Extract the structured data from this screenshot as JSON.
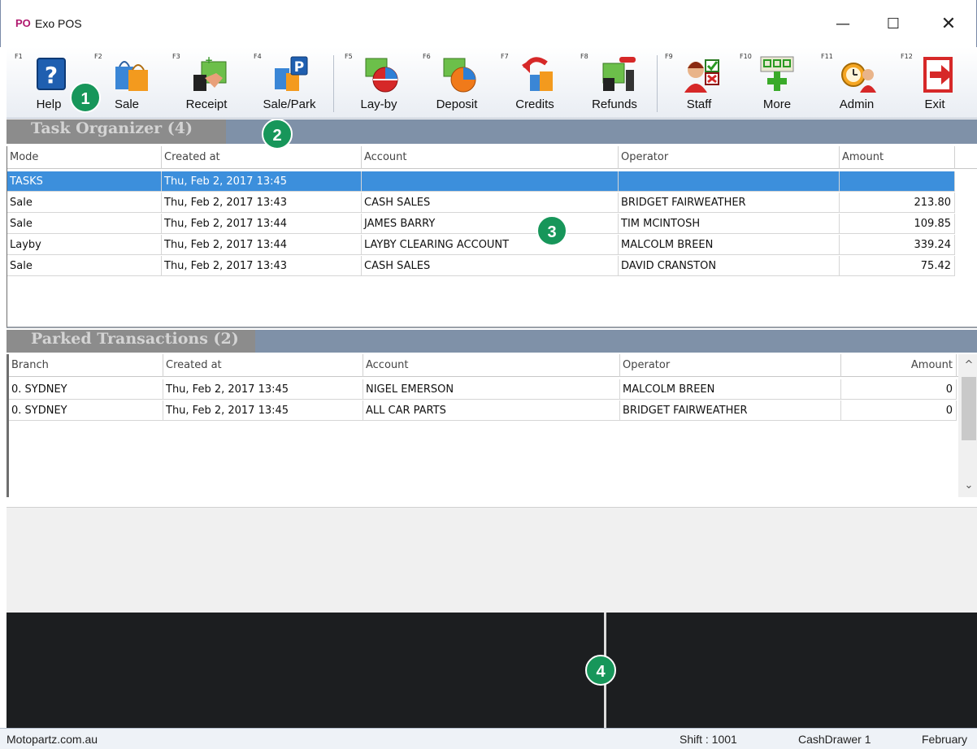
{
  "window": {
    "logo": "PO",
    "title": "Exo POS",
    "minimize": "—",
    "maximize": "☐",
    "close": "✕"
  },
  "toolbar": [
    {
      "key": "F1",
      "label": "Help",
      "icon": "help-icon"
    },
    {
      "key": "F2",
      "label": "Sale",
      "icon": "shopping-bags-icon"
    },
    {
      "key": "F3",
      "label": "Receipt",
      "icon": "receipt-icon"
    },
    {
      "key": "F4",
      "label": "Sale/Park",
      "icon": "sale-park-icon"
    },
    {
      "key": "F5",
      "label": "Lay-by",
      "icon": "layby-icon"
    },
    {
      "key": "F6",
      "label": "Deposit",
      "icon": "deposit-icon"
    },
    {
      "key": "F7",
      "label": "Credits",
      "icon": "credits-icon"
    },
    {
      "key": "F8",
      "label": "Refunds",
      "icon": "refunds-icon"
    },
    {
      "key": "F9",
      "label": "Staff",
      "icon": "staff-icon"
    },
    {
      "key": "F10",
      "label": "More",
      "icon": "more-icon"
    },
    {
      "key": "F11",
      "label": "Admin",
      "icon": "admin-icon"
    },
    {
      "key": "F12",
      "label": "Exit",
      "icon": "exit-icon"
    }
  ],
  "task_organizer": {
    "title": "Task Organizer (4)",
    "columns": [
      "Mode",
      "Created at",
      "Account",
      "Operator",
      "Amount"
    ],
    "rows": [
      {
        "mode": "TASKS",
        "created": "Thu, Feb 2, 2017  13:45",
        "account": "",
        "operator": "",
        "amount": "",
        "selected": true
      },
      {
        "mode": "Sale",
        "created": "Thu, Feb 2, 2017  13:43",
        "account": "CASH SALES",
        "operator": "BRIDGET FAIRWEATHER",
        "amount": "213.80"
      },
      {
        "mode": "Sale",
        "created": "Thu, Feb 2, 2017  13:44",
        "account": "JAMES BARRY",
        "operator": "TIM MCINTOSH",
        "amount": "109.85"
      },
      {
        "mode": "Layby",
        "created": "Thu, Feb 2, 2017  13:44",
        "account": "LAYBY CLEARING ACCOUNT",
        "operator": "MALCOLM BREEN",
        "amount": "339.24"
      },
      {
        "mode": "Sale",
        "created": "Thu, Feb 2, 2017  13:43",
        "account": "CASH SALES",
        "operator": "DAVID CRANSTON",
        "amount": "75.42"
      }
    ]
  },
  "parked": {
    "title": "Parked Transactions (2)",
    "columns": [
      "Branch",
      "Created at",
      "Account",
      "Operator",
      "Amount"
    ],
    "rows": [
      {
        "branch": "0. SYDNEY",
        "created": "Thu, Feb 2, 2017  13:45",
        "account": "NIGEL EMERSON",
        "operator": "MALCOLM BREEN",
        "amount": "0"
      },
      {
        "branch": "0. SYDNEY",
        "created": "Thu, Feb 2, 2017  13:45",
        "account": "ALL CAR PARTS",
        "operator": "BRIDGET FAIRWEATHER",
        "amount": "0"
      }
    ],
    "scroll_up": "^",
    "scroll_down": "⌄"
  },
  "status_bar": {
    "site": "Motopartz.com.au",
    "shift": "Shift : 1001",
    "drawer": "CashDrawer 1",
    "date": "February"
  },
  "callouts": [
    "1",
    "2",
    "3",
    "4"
  ],
  "colors": {
    "selection": "#3c8fdc",
    "section_header": "#8c8c8c",
    "display_panel": "#1c1e20",
    "callout": "#17965a"
  }
}
